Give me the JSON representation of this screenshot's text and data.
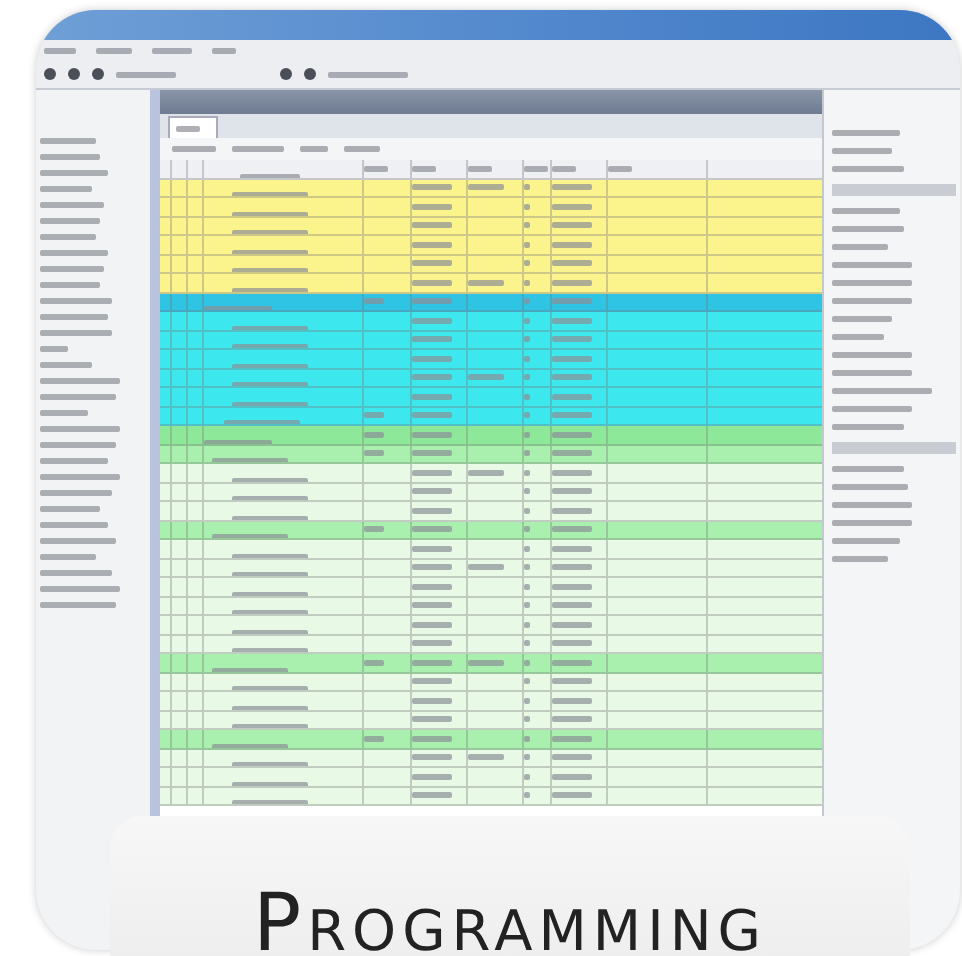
{
  "caption": {
    "title": "Programming"
  },
  "rows": [
    {
      "kind": "item",
      "color": "#fbf38c"
    },
    {
      "kind": "item",
      "color": "#fbf38c"
    },
    {
      "kind": "item",
      "color": "#fbf38c"
    },
    {
      "kind": "item",
      "color": "#fbf38c"
    },
    {
      "kind": "item",
      "color": "#fbf38c"
    },
    {
      "kind": "item",
      "color": "#fbf38c"
    },
    {
      "kind": "group",
      "color": "#2fc4e4"
    },
    {
      "kind": "item",
      "color": "#3ce8ee"
    },
    {
      "kind": "item",
      "color": "#3ce8ee"
    },
    {
      "kind": "item",
      "color": "#3ce8ee"
    },
    {
      "kind": "item",
      "color": "#3ce8ee"
    },
    {
      "kind": "item",
      "color": "#3ce8ee"
    },
    {
      "kind": "total",
      "color": "#3ce8ee"
    },
    {
      "kind": "group",
      "color": "#8ee89a"
    },
    {
      "kind": "subgroup",
      "color": "#a9f0ae"
    },
    {
      "kind": "item",
      "color": "#e8f9e6"
    },
    {
      "kind": "item",
      "color": "#e8f9e6"
    },
    {
      "kind": "item",
      "color": "#e8f9e6"
    },
    {
      "kind": "subgroup",
      "color": "#a9f0ae"
    },
    {
      "kind": "item",
      "color": "#e8f9e6"
    },
    {
      "kind": "item",
      "color": "#e8f9e6"
    },
    {
      "kind": "item",
      "color": "#e8f9e6"
    },
    {
      "kind": "item",
      "color": "#e8f9e6"
    },
    {
      "kind": "item",
      "color": "#e8f9e6"
    },
    {
      "kind": "item",
      "color": "#e8f9e6"
    },
    {
      "kind": "subgroup",
      "color": "#a9f0ae"
    },
    {
      "kind": "item",
      "color": "#e8f9e6"
    },
    {
      "kind": "item",
      "color": "#e8f9e6"
    },
    {
      "kind": "item",
      "color": "#e8f9e6"
    },
    {
      "kind": "subgroup",
      "color": "#a9f0ae"
    },
    {
      "kind": "item",
      "color": "#e8f9e6"
    },
    {
      "kind": "item",
      "color": "#e8f9e6"
    },
    {
      "kind": "item",
      "color": "#e8f9e6"
    }
  ]
}
